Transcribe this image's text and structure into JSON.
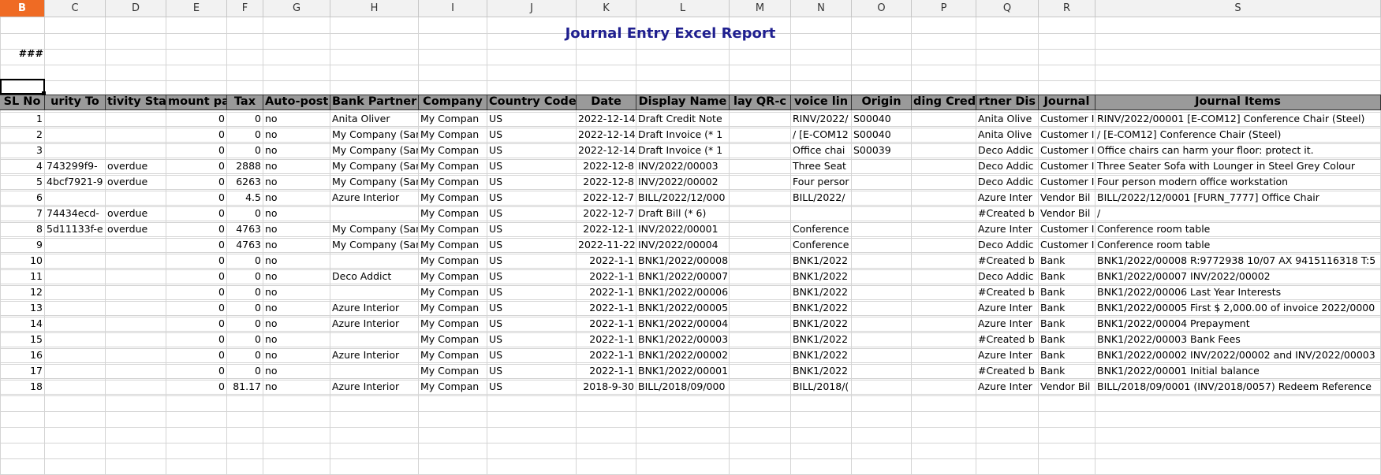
{
  "columns": [
    "B",
    "C",
    "D",
    "E",
    "F",
    "G",
    "H",
    "I",
    "J",
    "K",
    "L",
    "M",
    "N",
    "O",
    "P",
    "Q",
    "R",
    "S"
  ],
  "selected_column": "B",
  "report_title": "Journal Entry Excel Report",
  "hash_cell": "###",
  "headers": [
    "SL No",
    "urity To",
    "tivity Sta",
    "mount pa",
    "Tax",
    "Auto-post",
    "Bank Partner",
    "Company",
    "Country Code",
    "Date",
    "Display Name",
    "lay QR-c",
    "voice lin",
    "Origin",
    "ding Credit",
    "rtner Dis",
    "Journal",
    "Journal Items"
  ],
  "rows": [
    [
      "1",
      "",
      "",
      "0",
      "0",
      "no",
      "Anita Oliver",
      "My Compan",
      "US",
      "2022-12-14",
      "Draft Credit Note",
      "",
      "RINV/2022/",
      "S00040",
      "",
      "Anita Olive",
      "Customer I",
      "RINV/2022/00001 [E-COM12] Conference Chair (Steel)"
    ],
    [
      "2",
      "",
      "",
      "0",
      "0",
      "no",
      "My Company (San",
      "My Compan",
      "US",
      "2022-12-14",
      "Draft Invoice (* 1",
      "",
      "/ [E-COM12",
      "S00040",
      "",
      "Anita Olive",
      "Customer I",
      "/ [E-COM12] Conference Chair (Steel)"
    ],
    [
      "3",
      "",
      "",
      "0",
      "0",
      "no",
      "My Company (San",
      "My Compan",
      "US",
      "2022-12-14",
      "Draft Invoice (* 1",
      "",
      "Office chai",
      "S00039",
      "",
      "Deco Addic",
      "Customer I",
      "Office chairs can harm your floor: protect it."
    ],
    [
      "4",
      "743299f9-",
      "overdue",
      "0",
      "2888",
      "no",
      "My Company (San",
      "My Compan",
      "US",
      "2022-12-8",
      "INV/2022/00003",
      "",
      "Three Seat",
      "",
      "",
      "Deco Addic",
      "Customer I",
      "Three Seater Sofa with Lounger in Steel Grey Colour"
    ],
    [
      "5",
      "4bcf7921-9",
      "overdue",
      "0",
      "6263",
      "no",
      "My Company (San",
      "My Compan",
      "US",
      "2022-12-8",
      "INV/2022/00002",
      "",
      "Four persor",
      "",
      "",
      "Deco Addic",
      "Customer I",
      "Four person modern office workstation"
    ],
    [
      "6",
      "",
      "",
      "0",
      "4.5",
      "no",
      "Azure Interior",
      "My Compan",
      "US",
      "2022-12-7",
      "BILL/2022/12/000",
      "",
      "BILL/2022/",
      "",
      "",
      "Azure Inter",
      "Vendor Bil",
      "BILL/2022/12/0001 [FURN_7777] Office Chair"
    ],
    [
      "7",
      "74434ecd-",
      "overdue",
      "0",
      "0",
      "no",
      "",
      "My Compan",
      "US",
      "2022-12-7",
      "Draft Bill (* 6)",
      "",
      "",
      "",
      "",
      "#Created b",
      "Vendor Bil",
      "/"
    ],
    [
      "8",
      "5d11133f-e",
      "overdue",
      "0",
      "4763",
      "no",
      "My Company (San",
      "My Compan",
      "US",
      "2022-12-1",
      "INV/2022/00001",
      "",
      "Conference",
      "",
      "",
      "Azure Inter",
      "Customer I",
      "Conference room table"
    ],
    [
      "9",
      "",
      "",
      "0",
      "4763",
      "no",
      "My Company (San",
      "My Compan",
      "US",
      "2022-11-22",
      "INV/2022/00004",
      "",
      "Conference",
      "",
      "",
      "Deco Addic",
      "Customer I",
      "Conference room table"
    ],
    [
      "10",
      "",
      "",
      "0",
      "0",
      "no",
      "",
      "My Compan",
      "US",
      "2022-1-1",
      "BNK1/2022/00008",
      "",
      "BNK1/2022",
      "",
      "",
      "#Created b",
      "Bank",
      "BNK1/2022/00008 R:9772938  10/07 AX 9415116318 T:5"
    ],
    [
      "11",
      "",
      "",
      "0",
      "0",
      "no",
      "Deco Addict",
      "My Compan",
      "US",
      "2022-1-1",
      "BNK1/2022/00007",
      "",
      "BNK1/2022",
      "",
      "",
      "Deco Addic",
      "Bank",
      "BNK1/2022/00007 INV/2022/00002"
    ],
    [
      "12",
      "",
      "",
      "0",
      "0",
      "no",
      "",
      "My Compan",
      "US",
      "2022-1-1",
      "BNK1/2022/00006",
      "",
      "BNK1/2022",
      "",
      "",
      "#Created b",
      "Bank",
      "BNK1/2022/00006 Last Year Interests"
    ],
    [
      "13",
      "",
      "",
      "0",
      "0",
      "no",
      "Azure Interior",
      "My Compan",
      "US",
      "2022-1-1",
      "BNK1/2022/00005",
      "",
      "BNK1/2022",
      "",
      "",
      "Azure Inter",
      "Bank",
      "BNK1/2022/00005 First $ 2,000.00 of invoice 2022/0000"
    ],
    [
      "14",
      "",
      "",
      "0",
      "0",
      "no",
      "Azure Interior",
      "My Compan",
      "US",
      "2022-1-1",
      "BNK1/2022/00004",
      "",
      "BNK1/2022",
      "",
      "",
      "Azure Inter",
      "Bank",
      "BNK1/2022/00004 Prepayment"
    ],
    [
      "15",
      "",
      "",
      "0",
      "0",
      "no",
      "",
      "My Compan",
      "US",
      "2022-1-1",
      "BNK1/2022/00003",
      "",
      "BNK1/2022",
      "",
      "",
      "#Created b",
      "Bank",
      "BNK1/2022/00003 Bank Fees"
    ],
    [
      "16",
      "",
      "",
      "0",
      "0",
      "no",
      "Azure Interior",
      "My Compan",
      "US",
      "2022-1-1",
      "BNK1/2022/00002",
      "",
      "BNK1/2022",
      "",
      "",
      "Azure Inter",
      "Bank",
      "BNK1/2022/00002 INV/2022/00002 and INV/2022/00003"
    ],
    [
      "17",
      "",
      "",
      "0",
      "0",
      "no",
      "",
      "My Compan",
      "US",
      "2022-1-1",
      "BNK1/2022/00001",
      "",
      "BNK1/2022",
      "",
      "",
      "#Created b",
      "Bank",
      "BNK1/2022/00001 Initial balance"
    ],
    [
      "18",
      "",
      "",
      "0",
      "81.17",
      "no",
      "Azure Interior",
      "My Compan",
      "US",
      "2018-9-30",
      "BILL/2018/09/000",
      "",
      "BILL/2018/(",
      "",
      "",
      "Azure Inter",
      "Vendor Bil",
      "BILL/2018/09/0001 (INV/2018/0057) Redeem Reference"
    ]
  ]
}
